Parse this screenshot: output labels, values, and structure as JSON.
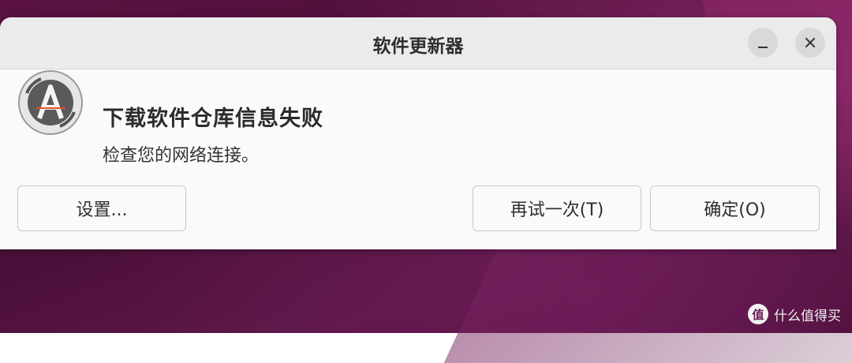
{
  "window": {
    "title": "软件更新器",
    "minimize_icon": "minimize-icon",
    "close_icon": "close-icon"
  },
  "message": {
    "icon": "software-updater-icon",
    "heading": "下载软件仓库信息失败",
    "detail": "检查您的网络连接。"
  },
  "buttons": {
    "settings": "设置...",
    "retry": "再试一次(T)",
    "ok": "确定(O)"
  },
  "watermark": {
    "badge": "值",
    "text": "什么值得买"
  },
  "colors": {
    "desktop": "#4a0f38",
    "dialog_bg": "#fafafa",
    "titlebar_bg": "#ebebeb",
    "accent_stroke": "#e95420"
  }
}
